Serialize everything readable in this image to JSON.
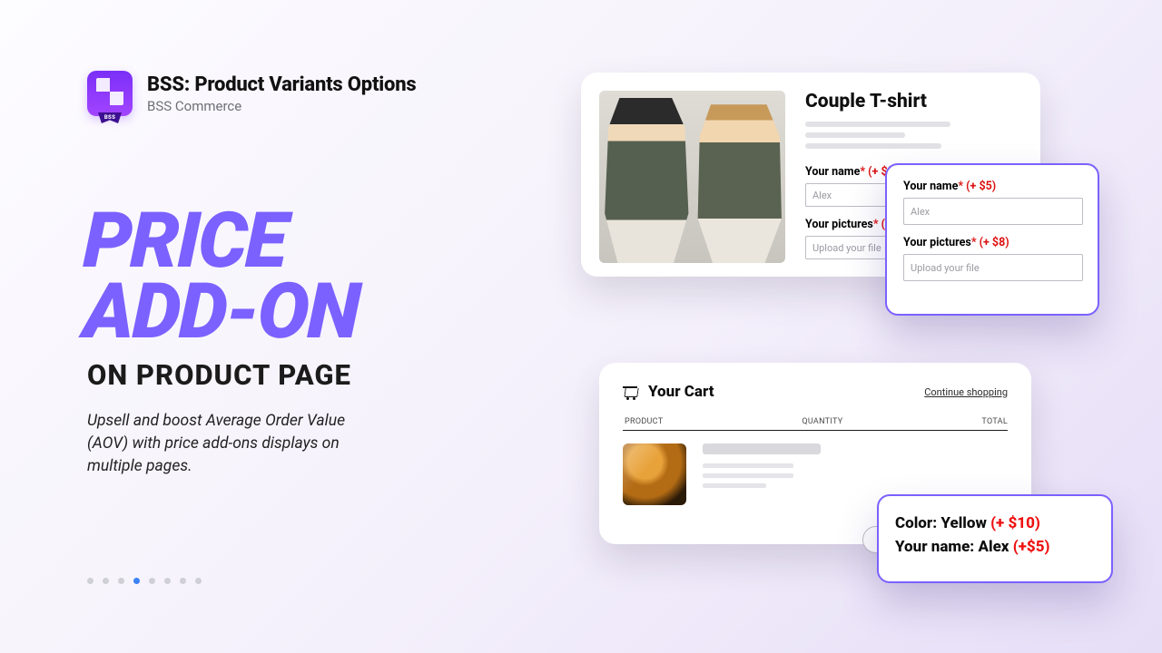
{
  "header": {
    "title": "BSS: Product Variants Options",
    "subtitle": "BSS Commerce",
    "logo_ribbon": "BSS"
  },
  "hero": {
    "line1": "PRICE",
    "line2": "ADD-ON",
    "sub": "ON PRODUCT PAGE",
    "desc": "Upsell and boost Average Order Value (AOV) with price add-ons displays on multiple pages."
  },
  "carousel": {
    "count": 8,
    "active_index": 3
  },
  "product": {
    "title": "Couple T-shirt",
    "field_name": {
      "label": "Your name",
      "required": "*",
      "addon": "(+ $5)",
      "placeholder": "Alex"
    },
    "field_pic": {
      "label": "Your pictures",
      "required": "*",
      "addon_trunc": "(",
      "placeholder": "Upload your file"
    }
  },
  "popout": {
    "field_name": {
      "label": "Your name",
      "required": "*",
      "addon": "(+ $5)",
      "value": "Alex"
    },
    "field_pic": {
      "label": "Your pictures",
      "required": "*",
      "addon": "(+ $8)",
      "placeholder": "Upload your file"
    }
  },
  "cart": {
    "title": "Your Cart",
    "continue": "Continue shopping",
    "cols": {
      "product": "PRODUCT",
      "qty": "QUANTITY",
      "total": "TOTAL"
    }
  },
  "summary": {
    "row1_label": "Color:",
    "row1_value": "Yellow",
    "row1_addon": "(+ $10)",
    "row2_label": "Your name:",
    "row2_value": "Alex",
    "row2_addon": "(+$5)"
  }
}
